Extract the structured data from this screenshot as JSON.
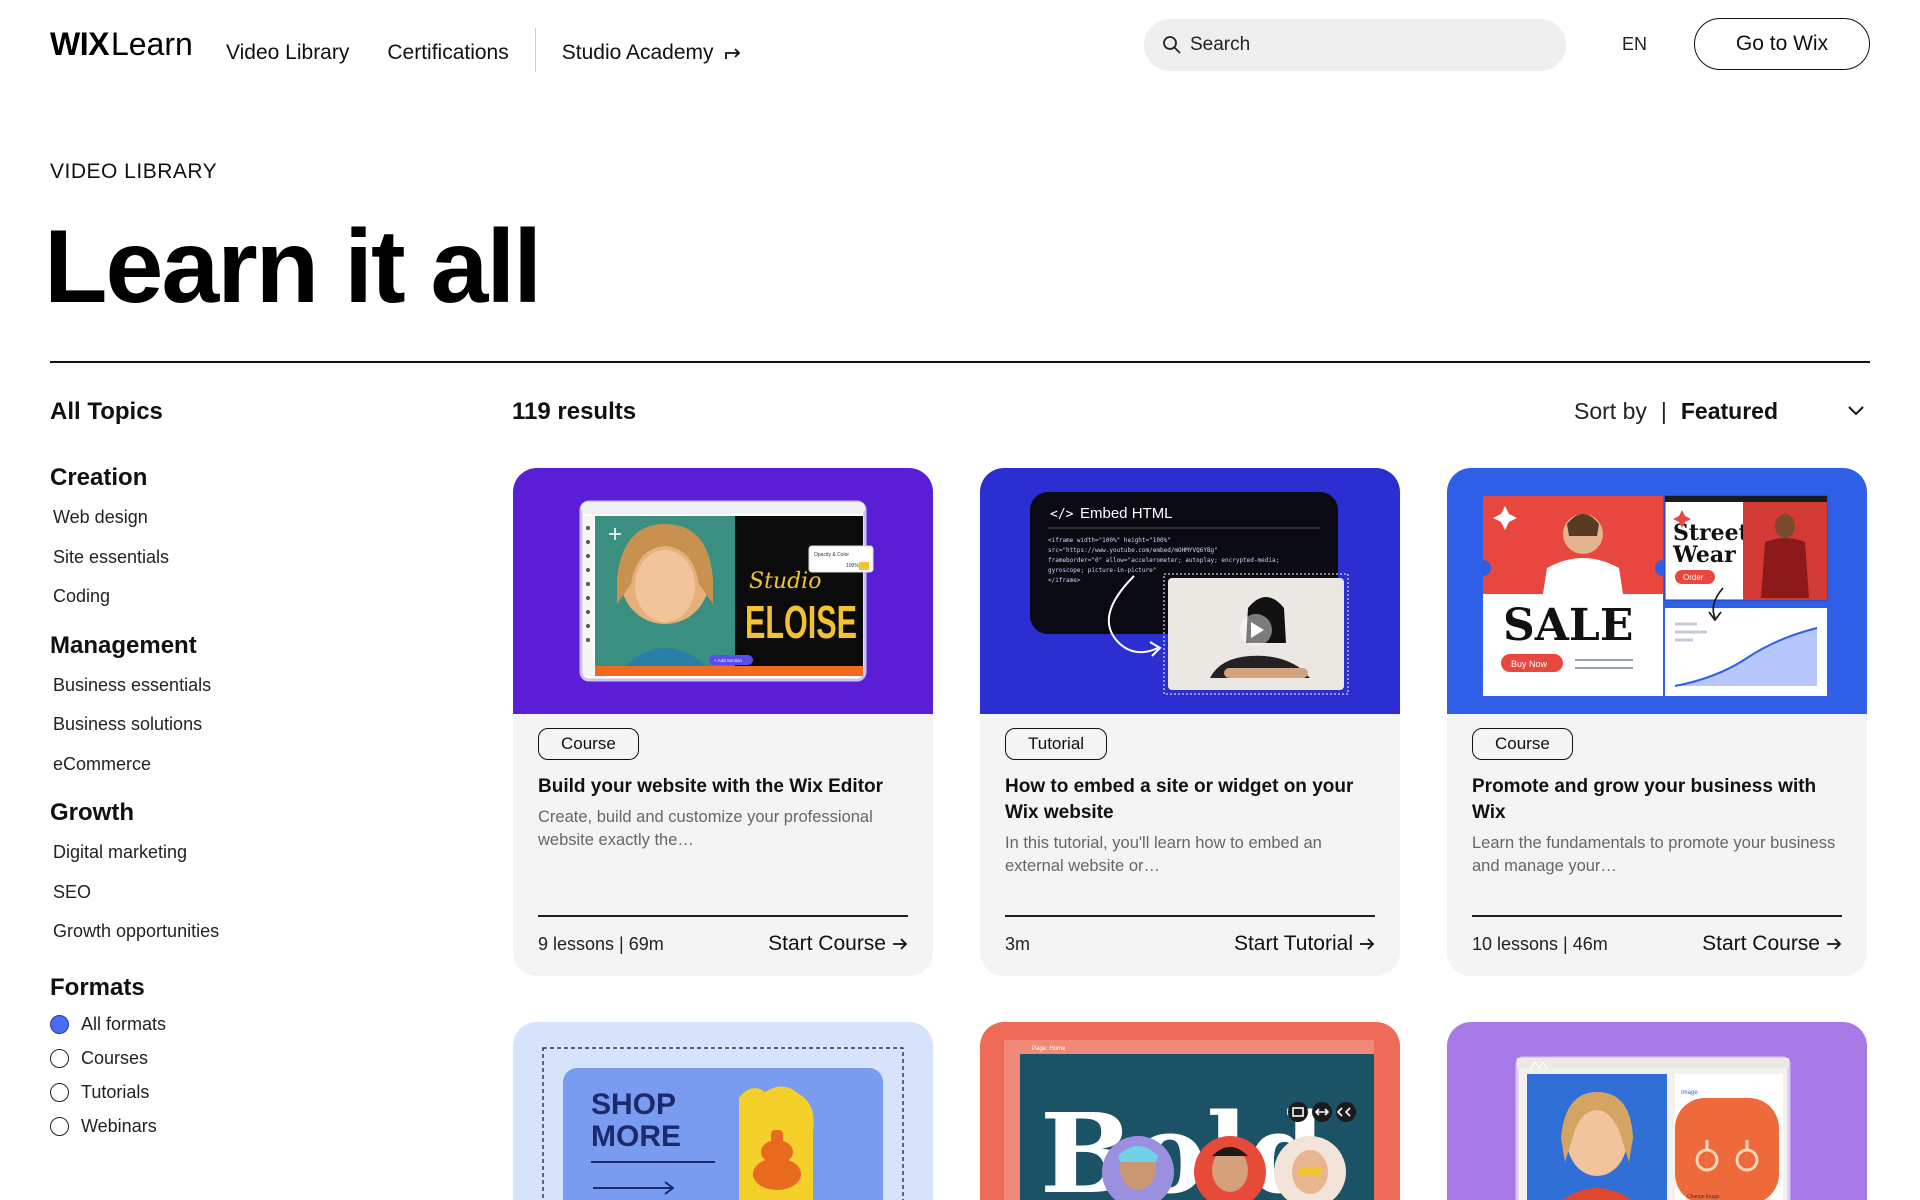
{
  "brand": {
    "wix": "WIX",
    "learn": "Learn"
  },
  "nav": {
    "video_library": "Video Library",
    "certifications": "Certifications",
    "studio_academy": "Studio Academy"
  },
  "search": {
    "placeholder": "Search"
  },
  "header": {
    "lang": "EN",
    "go_to_wix": "Go to Wix"
  },
  "hero": {
    "eyebrow": "VIDEO LIBRARY",
    "title": "Learn it all"
  },
  "sidebar": {
    "all_topics": "All Topics",
    "groups": [
      {
        "title": "Creation",
        "items": [
          "Web design",
          "Site essentials",
          "Coding"
        ]
      },
      {
        "title": "Management",
        "items": [
          "Business essentials",
          "Business solutions",
          "eCommerce"
        ]
      },
      {
        "title": "Growth",
        "items": [
          "Digital marketing",
          "SEO",
          "Growth opportunities"
        ]
      }
    ],
    "formats": {
      "title": "Formats",
      "options": [
        "All formats",
        "Courses",
        "Tutorials",
        "Webinars"
      ],
      "selected": "All formats"
    }
  },
  "results": {
    "count": "119 results",
    "sort_label": "Sort by",
    "sort_sep": "|",
    "sort_value": "Featured"
  },
  "cards": [
    {
      "badge": "Course",
      "title": "Build your website with the Wix Editor",
      "desc": "Create, build and customize your professional website exactly the…",
      "meta": "9 lessons | 69m",
      "cta": "Start Course",
      "thumb": {
        "bg": "#5a1ed6",
        "script": "Studio",
        "brand": "ELOISE",
        "mini": "Opacity & Color",
        "pct": "100%",
        "add_section": "+ Add Section"
      }
    },
    {
      "badge": "Tutorial",
      "title": "How to embed a site or widget on your Wix website",
      "desc": "In this tutorial, you'll learn how to embed an external website or…",
      "meta": "3m",
      "cta": "Start Tutorial",
      "thumb": {
        "bg": "#2b2fd1",
        "panel_title": "Embed HTML",
        "code": [
          "<iframe width=\"100%\" height=\"100%\"",
          "src=\"https://www.youtube.com/embed/mOHMYVQ6YBg\"",
          "frameborder=\"0\" allow=\"accelerometer; autoplay; encrypted-media;",
          "gyroscope; picture-in-picture\"",
          "</iframe>"
        ]
      }
    },
    {
      "badge": "Course",
      "title": "Promote and grow your business with Wix",
      "desc": "Learn the fundamentals to promote your business and manage your…",
      "meta": "10 lessons | 46m",
      "cta": "Start Course",
      "thumb": {
        "bg": "#2e5fe6",
        "sale": "SALE",
        "buy_now": "Buy Now",
        "street": "Street",
        "wear": "Wear",
        "order": "Order"
      }
    },
    {
      "thumb": {
        "bg": "#d6e3fb",
        "line1": "SHOP",
        "line2": "MORE"
      }
    },
    {
      "thumb": {
        "bg": "#ee6b57",
        "word": "Bold",
        "page": "Page: Home"
      }
    },
    {
      "thumb": {
        "bg": "#a77ae8",
        "image_label": "Image",
        "change": "Change Image"
      }
    }
  ],
  "colors": {
    "accent_radio": "#4a6cf5"
  }
}
